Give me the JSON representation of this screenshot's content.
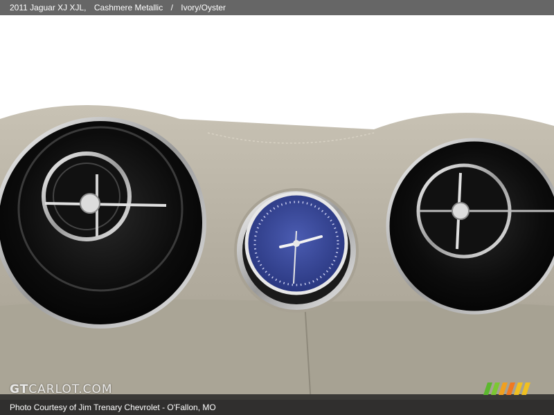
{
  "header": {
    "vehicle": "2011 Jaguar XJ XJL,",
    "exterior": "Cashmere Metallic",
    "separator": "/",
    "interior": "Ivory/Oyster"
  },
  "watermark": {
    "brand_prefix": "GT",
    "brand_rest": "CARLOT.COM"
  },
  "footer": {
    "credit": "Photo Courtesy of Jim Trenary Chevrolet - O'Fallon, MO"
  },
  "colors": {
    "title_bar": "#666666",
    "dashboard": "#b8b2a4",
    "clock_face": "#3a4a9a",
    "chrome": "#d8d8d8"
  },
  "stripe_colors": [
    "#5cb82e",
    "#7cc832",
    "#f0a020",
    "#f07820",
    "#f0c020"
  ]
}
